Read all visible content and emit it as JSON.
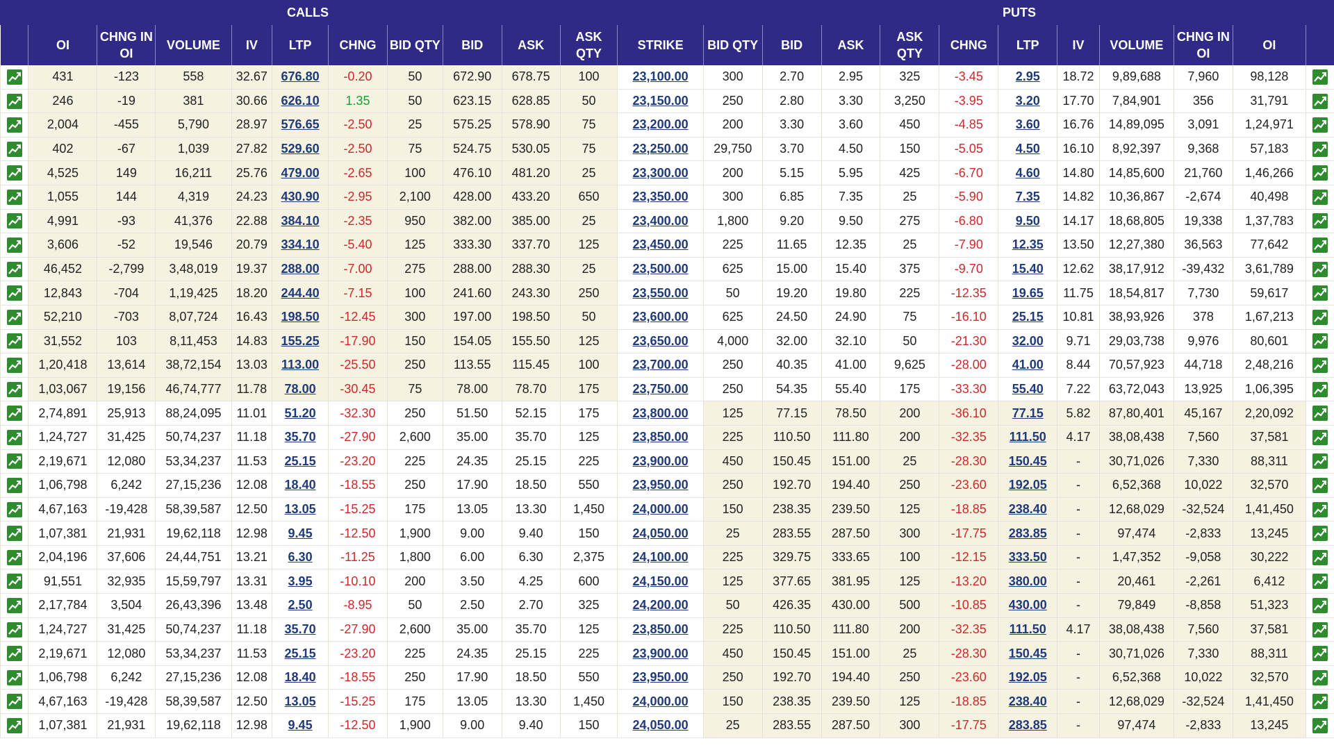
{
  "header": {
    "calls_label": "CALLS",
    "puts_label": "PUTS",
    "columns": [
      "OI",
      "CHNG IN OI",
      "VOLUME",
      "IV",
      "LTP",
      "CHNG",
      "BID QTY",
      "BID",
      "ASK",
      "ASK QTY",
      "STRIKE",
      "BID QTY",
      "BID",
      "ASK",
      "ASK QTY",
      "CHNG",
      "LTP",
      "IV",
      "VOLUME",
      "CHNG IN OI",
      "OI"
    ]
  },
  "colors": {
    "header_bg": "#2e2a86",
    "itm_bg": "#f5f2e1",
    "negative": "#d0272a",
    "positive": "#1e9b2f",
    "link": "#1f3a7a"
  },
  "icons": {
    "chart": "chart-icon"
  },
  "rows": [
    {
      "itm": "call",
      "c": [
        "431",
        "-123",
        "558",
        "32.67",
        "676.80",
        "-0.20",
        "50",
        "672.90",
        "678.75",
        "100"
      ],
      "strike": "23,100.00",
      "p": [
        "300",
        "2.70",
        "2.95",
        "325",
        "-3.45",
        "2.95",
        "18.72",
        "9,89,688",
        "7,960",
        "98,128"
      ]
    },
    {
      "itm": "call",
      "c": [
        "246",
        "-19",
        "381",
        "30.66",
        "626.10",
        "1.35",
        "50",
        "623.15",
        "628.85",
        "50"
      ],
      "strike": "23,150.00",
      "p": [
        "250",
        "2.80",
        "3.30",
        "3,250",
        "-3.95",
        "3.20",
        "17.70",
        "7,84,901",
        "356",
        "31,791"
      ]
    },
    {
      "itm": "call",
      "c": [
        "2,004",
        "-455",
        "5,790",
        "28.97",
        "576.65",
        "-2.50",
        "25",
        "575.25",
        "578.90",
        "75"
      ],
      "strike": "23,200.00",
      "p": [
        "200",
        "3.30",
        "3.60",
        "450",
        "-4.85",
        "3.60",
        "16.76",
        "14,89,095",
        "3,091",
        "1,24,971"
      ]
    },
    {
      "itm": "call",
      "c": [
        "402",
        "-67",
        "1,039",
        "27.82",
        "529.60",
        "-2.50",
        "75",
        "524.75",
        "530.05",
        "75"
      ],
      "strike": "23,250.00",
      "p": [
        "29,750",
        "3.70",
        "4.50",
        "150",
        "-5.05",
        "4.50",
        "16.10",
        "8,92,397",
        "9,368",
        "57,183"
      ]
    },
    {
      "itm": "call",
      "c": [
        "4,525",
        "149",
        "16,211",
        "25.76",
        "479.00",
        "-2.65",
        "100",
        "476.10",
        "481.20",
        "25"
      ],
      "strike": "23,300.00",
      "p": [
        "200",
        "5.15",
        "5.95",
        "425",
        "-6.70",
        "4.60",
        "14.80",
        "14,85,600",
        "21,760",
        "1,46,266"
      ]
    },
    {
      "itm": "call",
      "c": [
        "1,055",
        "144",
        "4,319",
        "24.23",
        "430.90",
        "-2.95",
        "2,100",
        "428.00",
        "433.20",
        "650"
      ],
      "strike": "23,350.00",
      "p": [
        "300",
        "6.85",
        "7.35",
        "25",
        "-5.90",
        "7.35",
        "14.82",
        "10,36,867",
        "-2,674",
        "40,498"
      ]
    },
    {
      "itm": "call",
      "c": [
        "4,991",
        "-93",
        "41,376",
        "22.88",
        "384.10",
        "-2.35",
        "950",
        "382.00",
        "385.00",
        "25"
      ],
      "strike": "23,400.00",
      "p": [
        "1,800",
        "9.20",
        "9.50",
        "275",
        "-6.80",
        "9.50",
        "14.17",
        "18,68,805",
        "19,338",
        "1,37,783"
      ]
    },
    {
      "itm": "call",
      "c": [
        "3,606",
        "-52",
        "19,546",
        "20.79",
        "334.10",
        "-5.40",
        "125",
        "333.30",
        "337.70",
        "125"
      ],
      "strike": "23,450.00",
      "p": [
        "225",
        "11.65",
        "12.35",
        "25",
        "-7.90",
        "12.35",
        "13.50",
        "12,27,380",
        "36,563",
        "77,642"
      ]
    },
    {
      "itm": "call",
      "c": [
        "46,452",
        "-2,799",
        "3,48,019",
        "19.37",
        "288.00",
        "-7.00",
        "275",
        "288.00",
        "288.30",
        "25"
      ],
      "strike": "23,500.00",
      "p": [
        "625",
        "15.00",
        "15.40",
        "375",
        "-9.70",
        "15.40",
        "12.62",
        "38,17,912",
        "-39,432",
        "3,61,789"
      ]
    },
    {
      "itm": "call",
      "c": [
        "12,843",
        "-704",
        "1,19,425",
        "18.20",
        "244.40",
        "-7.15",
        "100",
        "241.60",
        "243.30",
        "250"
      ],
      "strike": "23,550.00",
      "p": [
        "50",
        "19.20",
        "19.80",
        "225",
        "-12.35",
        "19.65",
        "11.75",
        "18,54,817",
        "7,730",
        "59,617"
      ]
    },
    {
      "itm": "call",
      "c": [
        "52,210",
        "-703",
        "8,07,724",
        "16.43",
        "198.50",
        "-12.45",
        "300",
        "197.00",
        "198.50",
        "50"
      ],
      "strike": "23,600.00",
      "p": [
        "625",
        "24.50",
        "24.90",
        "75",
        "-16.10",
        "25.15",
        "10.81",
        "38,93,926",
        "378",
        "1,67,213"
      ]
    },
    {
      "itm": "call",
      "c": [
        "31,552",
        "103",
        "8,11,453",
        "14.83",
        "155.25",
        "-17.90",
        "150",
        "154.05",
        "155.50",
        "125"
      ],
      "strike": "23,650.00",
      "p": [
        "4,000",
        "32.00",
        "32.10",
        "50",
        "-21.30",
        "32.00",
        "9.71",
        "29,03,738",
        "9,976",
        "80,601"
      ]
    },
    {
      "itm": "call",
      "c": [
        "1,20,418",
        "13,614",
        "38,72,154",
        "13.03",
        "113.00",
        "-25.50",
        "250",
        "113.55",
        "115.45",
        "100"
      ],
      "strike": "23,700.00",
      "p": [
        "250",
        "40.35",
        "41.00",
        "9,625",
        "-28.00",
        "41.00",
        "8.44",
        "70,57,923",
        "44,718",
        "2,48,216"
      ]
    },
    {
      "itm": "call",
      "c": [
        "1,03,067",
        "19,156",
        "46,74,777",
        "11.78",
        "78.00",
        "-30.45",
        "75",
        "78.00",
        "78.70",
        "175"
      ],
      "strike": "23,750.00",
      "p": [
        "250",
        "54.35",
        "55.40",
        "175",
        "-33.30",
        "55.40",
        "7.22",
        "63,72,043",
        "13,925",
        "1,06,395"
      ]
    },
    {
      "itm": "put",
      "c": [
        "2,74,891",
        "25,913",
        "88,24,095",
        "11.01",
        "51.20",
        "-32.30",
        "250",
        "51.50",
        "52.15",
        "175"
      ],
      "strike": "23,800.00",
      "p": [
        "125",
        "77.15",
        "78.50",
        "200",
        "-36.10",
        "77.15",
        "5.82",
        "87,80,401",
        "45,167",
        "2,20,092"
      ]
    },
    {
      "itm": "put",
      "c": [
        "1,24,727",
        "31,425",
        "50,74,237",
        "11.18",
        "35.70",
        "-27.90",
        "2,600",
        "35.00",
        "35.70",
        "125"
      ],
      "strike": "23,850.00",
      "p": [
        "225",
        "110.50",
        "111.80",
        "200",
        "-32.35",
        "111.50",
        "4.17",
        "38,08,438",
        "7,560",
        "37,581"
      ]
    },
    {
      "itm": "put",
      "c": [
        "2,19,671",
        "12,080",
        "53,34,237",
        "11.53",
        "25.15",
        "-23.20",
        "225",
        "24.35",
        "25.15",
        "225"
      ],
      "strike": "23,900.00",
      "p": [
        "450",
        "150.45",
        "151.00",
        "25",
        "-28.30",
        "150.45",
        "-",
        "30,71,026",
        "7,330",
        "88,311"
      ]
    },
    {
      "itm": "put",
      "c": [
        "1,06,798",
        "6,242",
        "27,15,236",
        "12.08",
        "18.40",
        "-18.55",
        "250",
        "17.90",
        "18.50",
        "550"
      ],
      "strike": "23,950.00",
      "p": [
        "250",
        "192.70",
        "194.40",
        "250",
        "-23.60",
        "192.05",
        "-",
        "6,52,368",
        "10,022",
        "32,570"
      ]
    },
    {
      "itm": "put",
      "c": [
        "4,67,163",
        "-19,428",
        "58,39,587",
        "12.50",
        "13.05",
        "-15.25",
        "175",
        "13.05",
        "13.30",
        "1,450"
      ],
      "strike": "24,000.00",
      "p": [
        "150",
        "238.35",
        "239.50",
        "125",
        "-18.85",
        "238.40",
        "-",
        "12,68,029",
        "-32,524",
        "1,41,450"
      ]
    },
    {
      "itm": "put",
      "c": [
        "1,07,381",
        "21,931",
        "19,62,118",
        "12.98",
        "9.45",
        "-12.50",
        "1,900",
        "9.00",
        "9.40",
        "150"
      ],
      "strike": "24,050.00",
      "p": [
        "25",
        "283.55",
        "287.50",
        "300",
        "-17.75",
        "283.85",
        "-",
        "97,474",
        "-2,833",
        "13,245"
      ]
    },
    {
      "itm": "put",
      "c": [
        "2,04,196",
        "37,606",
        "24,44,751",
        "13.21",
        "6.30",
        "-11.25",
        "1,800",
        "6.00",
        "6.30",
        "2,375"
      ],
      "strike": "24,100.00",
      "p": [
        "225",
        "329.75",
        "333.65",
        "100",
        "-12.15",
        "333.50",
        "-",
        "1,47,352",
        "-9,058",
        "30,222"
      ]
    },
    {
      "itm": "put",
      "c": [
        "91,551",
        "32,935",
        "15,59,797",
        "13.31",
        "3.95",
        "-10.10",
        "200",
        "3.50",
        "4.25",
        "600"
      ],
      "strike": "24,150.00",
      "p": [
        "125",
        "377.65",
        "381.95",
        "125",
        "-13.20",
        "380.00",
        "-",
        "20,461",
        "-2,261",
        "6,412"
      ]
    },
    {
      "itm": "put",
      "c": [
        "2,17,784",
        "3,504",
        "26,43,396",
        "13.48",
        "2.50",
        "-8.95",
        "50",
        "2.50",
        "2.70",
        "325"
      ],
      "strike": "24,200.00",
      "p": [
        "50",
        "426.35",
        "430.00",
        "500",
        "-10.85",
        "430.00",
        "-",
        "79,849",
        "-8,858",
        "51,323"
      ]
    },
    {
      "itm": "put",
      "c": [
        "1,24,727",
        "31,425",
        "50,74,237",
        "11.18",
        "35.70",
        "-27.90",
        "2,600",
        "35.00",
        "35.70",
        "125"
      ],
      "strike": "23,850.00",
      "p": [
        "225",
        "110.50",
        "111.80",
        "200",
        "-32.35",
        "111.50",
        "4.17",
        "38,08,438",
        "7,560",
        "37,581"
      ]
    },
    {
      "itm": "put",
      "c": [
        "2,19,671",
        "12,080",
        "53,34,237",
        "11.53",
        "25.15",
        "-23.20",
        "225",
        "24.35",
        "25.15",
        "225"
      ],
      "strike": "23,900.00",
      "p": [
        "450",
        "150.45",
        "151.00",
        "25",
        "-28.30",
        "150.45",
        "-",
        "30,71,026",
        "7,330",
        "88,311"
      ]
    },
    {
      "itm": "put",
      "c": [
        "1,06,798",
        "6,242",
        "27,15,236",
        "12.08",
        "18.40",
        "-18.55",
        "250",
        "17.90",
        "18.50",
        "550"
      ],
      "strike": "23,950.00",
      "p": [
        "250",
        "192.70",
        "194.40",
        "250",
        "-23.60",
        "192.05",
        "-",
        "6,52,368",
        "10,022",
        "32,570"
      ]
    },
    {
      "itm": "put",
      "c": [
        "4,67,163",
        "-19,428",
        "58,39,587",
        "12.50",
        "13.05",
        "-15.25",
        "175",
        "13.05",
        "13.30",
        "1,450"
      ],
      "strike": "24,000.00",
      "p": [
        "150",
        "238.35",
        "239.50",
        "125",
        "-18.85",
        "238.40",
        "-",
        "12,68,029",
        "-32,524",
        "1,41,450"
      ]
    },
    {
      "itm": "put",
      "c": [
        "1,07,381",
        "21,931",
        "19,62,118",
        "12.98",
        "9.45",
        "-12.50",
        "1,900",
        "9.00",
        "9.40",
        "150"
      ],
      "strike": "24,050.00",
      "p": [
        "25",
        "283.55",
        "287.50",
        "300",
        "-17.75",
        "283.85",
        "-",
        "97,474",
        "-2,833",
        "13,245"
      ]
    }
  ]
}
